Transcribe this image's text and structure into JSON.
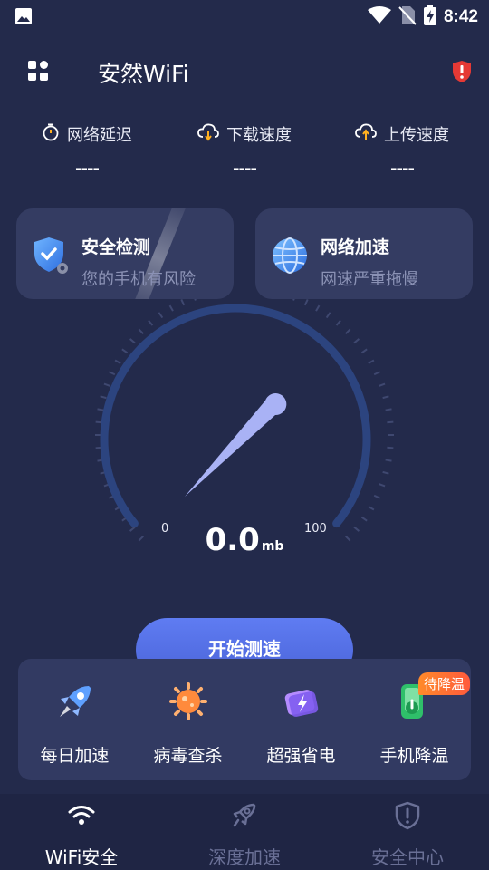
{
  "status_bar": {
    "time": "8:42"
  },
  "header": {
    "title": "安然WiFi"
  },
  "stats": [
    {
      "label": "网络延迟",
      "value": "----"
    },
    {
      "label": "下载速度",
      "value": "----"
    },
    {
      "label": "上传速度",
      "value": "----"
    }
  ],
  "cards": [
    {
      "title": "安全检测",
      "subtitle": "您的手机有风险"
    },
    {
      "title": "网络加速",
      "subtitle": "网速严重拖慢"
    }
  ],
  "gauge": {
    "min_label": "0",
    "max_label": "100",
    "speed": "0.0",
    "unit": "mb"
  },
  "start_button": {
    "label": "开始测速"
  },
  "tools": [
    {
      "label": "每日加速"
    },
    {
      "label": "病毒查杀"
    },
    {
      "label": "超强省电"
    },
    {
      "label": "手机降温",
      "badge": "待降温"
    }
  ],
  "bottom_nav": [
    {
      "label": "WiFi安全",
      "active": true
    },
    {
      "label": "深度加速",
      "active": false
    },
    {
      "label": "安全中心",
      "active": false
    }
  ],
  "colors": {
    "background": "#232a4b",
    "card": "#343c62",
    "accent": "#5f7cf2",
    "needle": "#a9b2f5",
    "badge": "#ff6a36",
    "alert": "#e53935"
  }
}
